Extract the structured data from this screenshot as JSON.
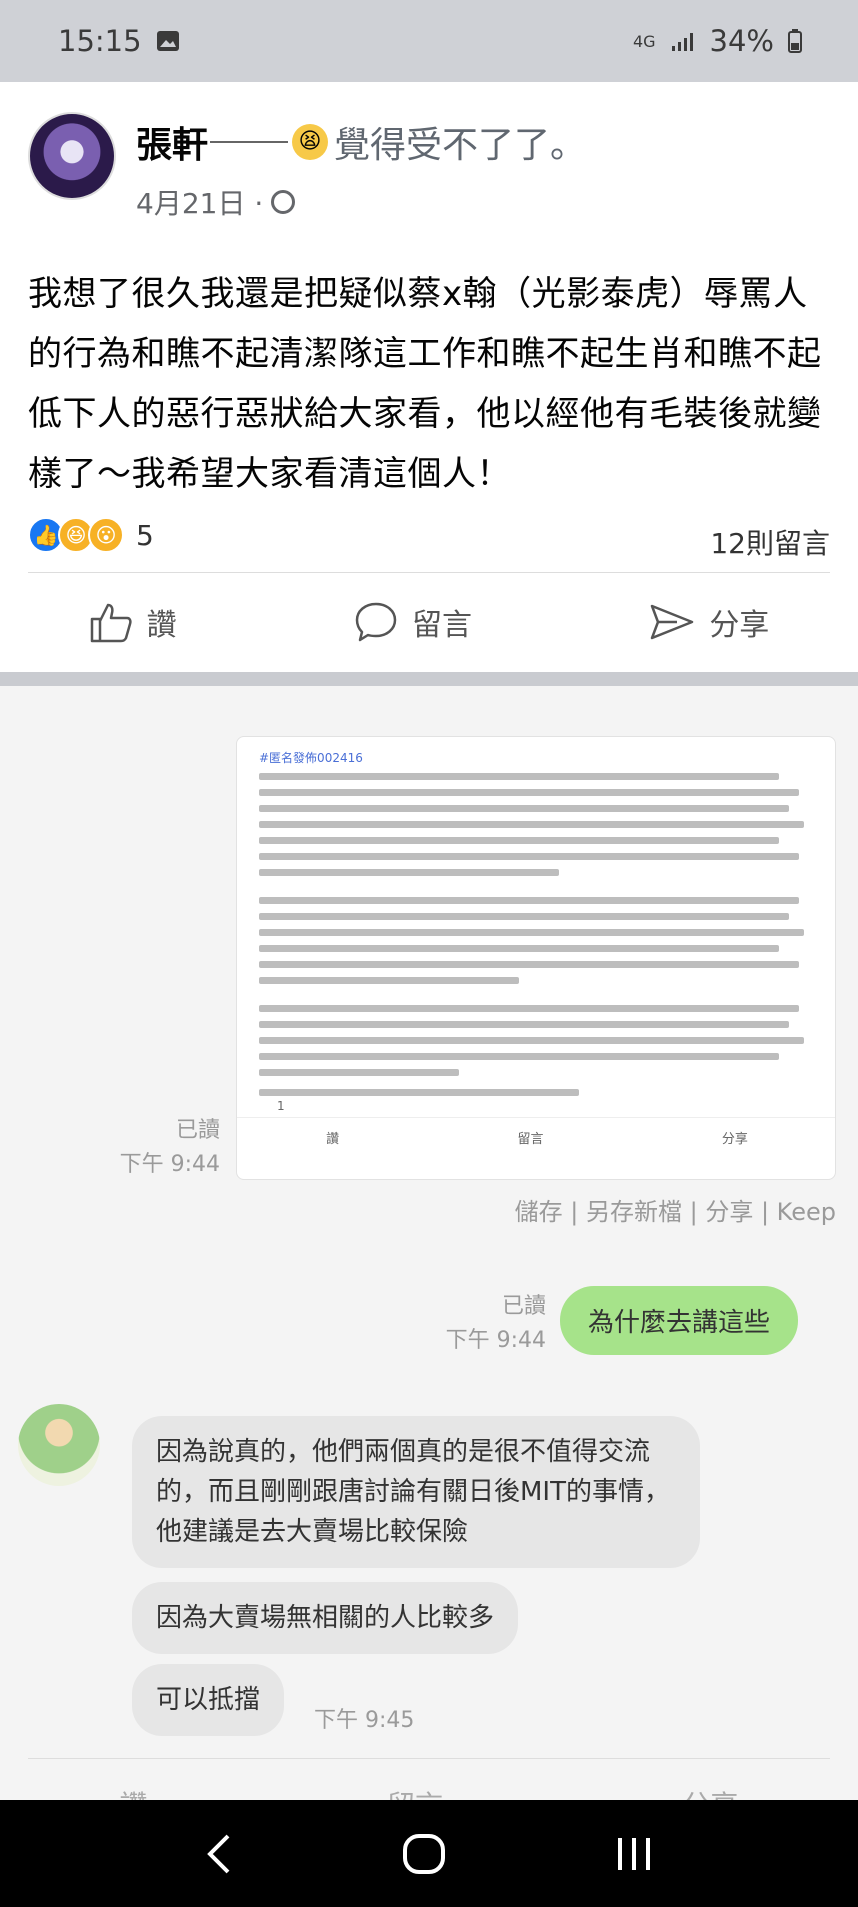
{
  "status": {
    "time": "15:15",
    "network": "4G",
    "battery": "34%"
  },
  "post": {
    "author": "張軒",
    "feeling": "覺得受不了了。",
    "feeling_emoji": "😫",
    "date": "4月21日 ·",
    "text": "我想了很久我還是把疑似蔡x翰（光影泰虎）辱罵人的行為和瞧不起清潔隊這工作和瞧不起生肖和瞧不起低下人的惡行惡狀給大家看，他以經他有毛裝後就變樣了～我希望大家看清這個人！",
    "reaction_count": "5",
    "comment_count": "12則留言",
    "actions": {
      "like": "讚",
      "comment": "留言",
      "share": "分享"
    }
  },
  "chat": {
    "card_tag": "#匿名發佈002416",
    "card_reaction": "1",
    "card_actions": [
      "讚",
      "留言",
      "分享"
    ],
    "read1": {
      "status": "已讀",
      "time": "下午 9:44"
    },
    "save_bar": "儲存 | 另存新檔 | 分享 | Keep",
    "read2": {
      "status": "已讀",
      "time": "下午 9:44"
    },
    "my_message": "為什麼去講這些",
    "friend_messages": [
      "因為說真的，他們兩個真的是很不值得交流的，而且剛剛跟唐討論有關日後MIT的事情，他建議是去大賣場比較保險",
      "因為大賣場無相關的人比較多",
      "可以抵擋"
    ],
    "friend_time": "下午 9:45",
    "ghost_actions": [
      "讚",
      "留言",
      "分享"
    ]
  },
  "colors": {
    "like_blue": "#1877f2",
    "chat_green": "#a6e38a"
  }
}
